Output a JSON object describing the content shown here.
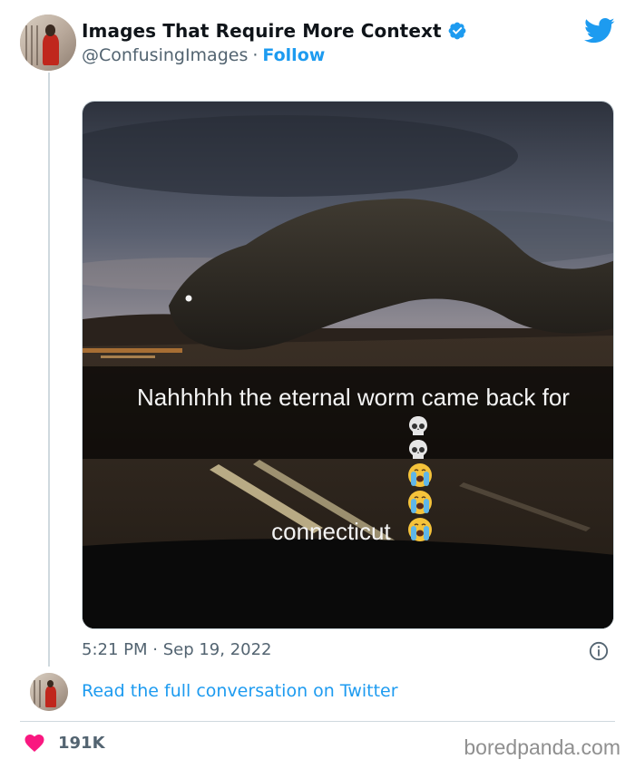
{
  "tweet": {
    "author_name": "Images That Require More Context",
    "handle": "@ConfusingImages",
    "separator": "·",
    "follow_label": "Follow",
    "media_caption_line1": "Nahhhhh the eternal worm came back for",
    "media_caption_line2": "connecticut",
    "caption_emojis": [
      "skull",
      "skull",
      "loudly-crying-face",
      "loudly-crying-face",
      "loudly-crying-face"
    ],
    "timestamp": "5:21 PM · Sep 19, 2022",
    "read_more_label": "Read the full conversation on Twitter",
    "likes_count": "191K"
  },
  "watermark": "boredpanda.com",
  "colors": {
    "twitter_blue": "#1d9bf0",
    "verified_blue": "#1d9bf0",
    "heart": "#f91880",
    "secondary_text": "#536471"
  },
  "icons": [
    "verified-badge-icon",
    "twitter-bird-icon",
    "info-icon",
    "heart-icon"
  ]
}
